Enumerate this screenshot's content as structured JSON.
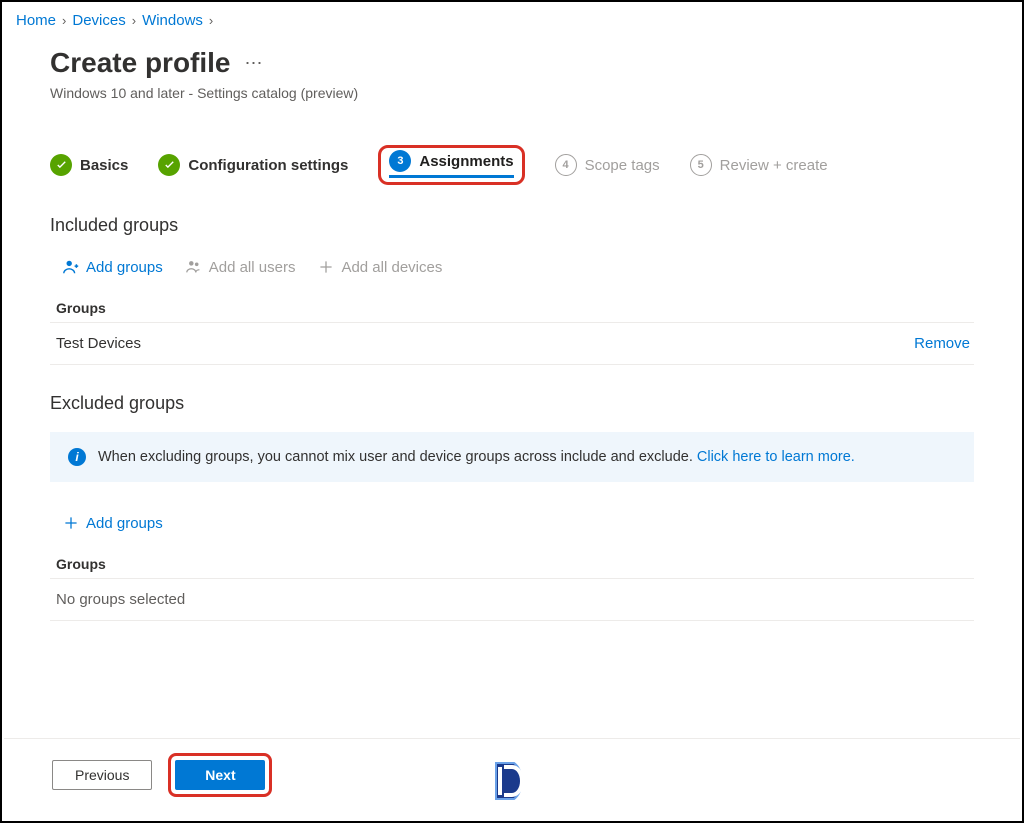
{
  "breadcrumb": [
    {
      "label": "Home"
    },
    {
      "label": "Devices"
    },
    {
      "label": "Windows"
    }
  ],
  "page": {
    "title": "Create profile",
    "subtitle": "Windows 10 and later - Settings catalog (preview)"
  },
  "steps": {
    "s1": {
      "label": "Basics"
    },
    "s2": {
      "label": "Configuration settings"
    },
    "s3": {
      "num": "3",
      "label": "Assignments"
    },
    "s4": {
      "num": "4",
      "label": "Scope tags"
    },
    "s5": {
      "num": "5",
      "label": "Review + create"
    }
  },
  "included": {
    "heading": "Included groups",
    "toolbar": {
      "add_groups": "Add groups",
      "add_all_users": "Add all users",
      "add_all_devices": "Add all devices"
    },
    "groups_label": "Groups",
    "rows": [
      {
        "name": "Test Devices",
        "remove": "Remove"
      }
    ]
  },
  "excluded": {
    "heading": "Excluded groups",
    "info_text": "When excluding groups, you cannot mix user and device groups across include and exclude. ",
    "info_link": "Click here to learn more.",
    "add_groups": "Add groups",
    "groups_label": "Groups",
    "empty": "No groups selected"
  },
  "footer": {
    "previous": "Previous",
    "next": "Next"
  }
}
